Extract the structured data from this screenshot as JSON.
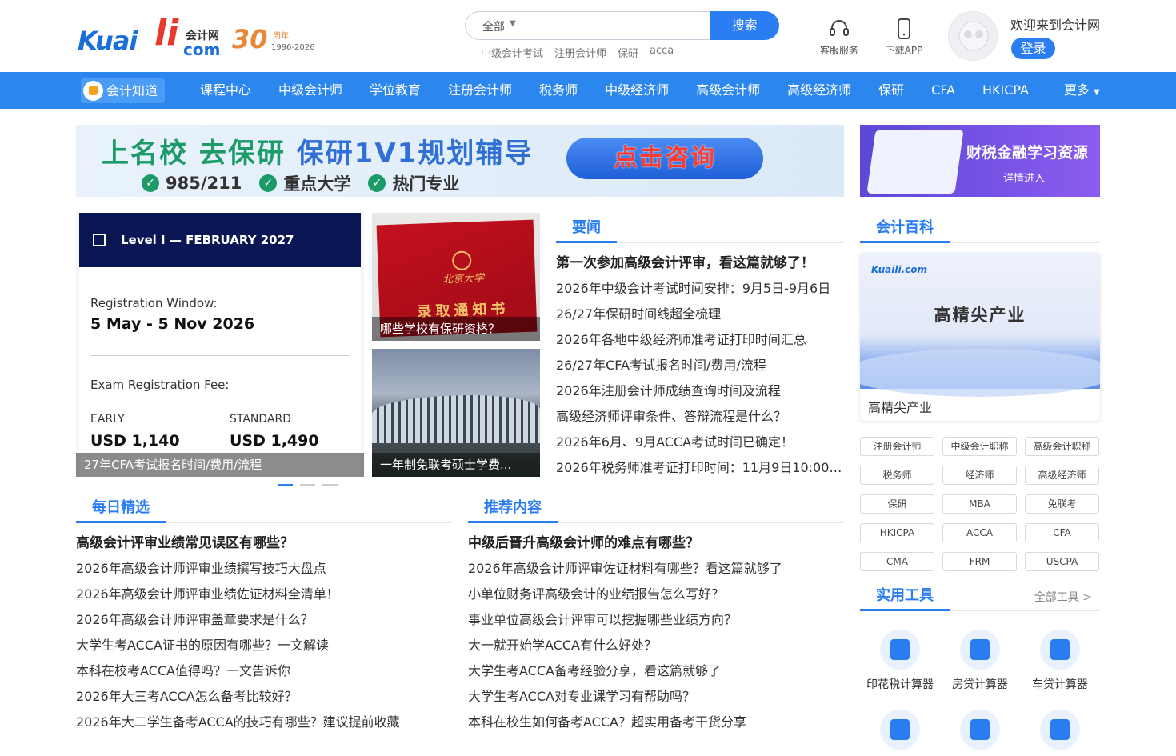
{
  "logo": {
    "kuai": "Kuai",
    "li": "li",
    "kjw": "会计网",
    "com": "com",
    "thirty": "30",
    "zhou": "周年",
    "years": "1996-2026"
  },
  "search": {
    "scope": "全部",
    "button": "搜索",
    "hotwords": [
      "中级会计考试",
      "注册会计师",
      "保研",
      "acca"
    ]
  },
  "header": {
    "service": "客服服务",
    "app": "下载APP",
    "welcome": "欢迎来到会计网",
    "login": "登录"
  },
  "nav": {
    "zhidao": "会计知道",
    "items": [
      "课程中心",
      "中级会计师",
      "学位教育",
      "注册会计师",
      "税务师",
      "中级经济师",
      "高级会计师",
      "高级经济师",
      "保研",
      "CFA",
      "HKICPA"
    ],
    "more": "更多"
  },
  "banner": {
    "line1a": "上名校 去保研 ",
    "line1b": "保研1V1规划辅导",
    "checks": [
      "985/211",
      "重点大学",
      "热门专业"
    ],
    "cta": "点击咨询"
  },
  "rbanner": {
    "title": "财税金融学习资源",
    "sub": "详情进入"
  },
  "slide": {
    "top": "Level I — FEBRUARY 2027",
    "reg_label": "Registration Window:",
    "reg_value": "5 May - 5 Nov 2026",
    "fee_label": "Exam Registration Fee:",
    "early": "EARLY",
    "standard": "STANDARD",
    "early_val": "USD 1,140",
    "standard_val": "USD 1,490",
    "caption": "27年CFA考试报名时间/费用/流程"
  },
  "thumbs": [
    {
      "pku": "北京大学",
      "tz": "录取通知书",
      "caption": "哪些学校有保研资格？"
    },
    {
      "caption": "一年制免联考硕士学费..."
    }
  ],
  "yaowen": {
    "title": "要闻",
    "items": [
      "第一次参加高级会计评审，看这篇就够了！",
      "2026年中级会计考试时间安排：9月5日-9月6日",
      "26/27年保研时间线超全梳理",
      "2026年各地中级经济师准考证打印时间汇总",
      "26/27年CFA考试报名时间/费用/流程",
      "2026年注册会计师成绩查询时间及流程",
      "高级经济师评审条件、答辩流程是什么？",
      "2026年6月、9月ACCA考试时间已确定！",
      "2026年税务师准考证打印时间：11月9日10:00至..."
    ]
  },
  "daily": {
    "title": "每日精选",
    "items": [
      "高级会计评审业绩常见误区有哪些？",
      "2026年高级会计师评审业绩撰写技巧大盘点",
      "2026年高级会计师评审业绩佐证材料全清单！",
      "2026年高级会计师评审盖章要求是什么？",
      "大学生考ACCA证书的原因有哪些？一文解读",
      "本科在校考ACCA值得吗？一文告诉你",
      "2026年大三考ACCA怎么备考比较好？",
      "2026年大二学生备考ACCA的技巧有哪些？建议提前收藏"
    ]
  },
  "recommend": {
    "title": "推荐内容",
    "items": [
      "中级后晋升高级会计师的难点有哪些？",
      "2026年高级会计师评审佐证材料有哪些？看这篇就够了",
      "小单位财务评高级会计的业绩报告怎么写好？",
      "事业单位高级会计评审可以挖掘哪些业绩方向？",
      "大一就开始学ACCA有什么好处？",
      "大学生考ACCA备考经验分享，看这篇就够了",
      "大学生考ACCA对专业课学习有帮助吗？",
      "本科在校生如何备考ACCA？超实用备考干货分享"
    ]
  },
  "baike": {
    "title": "会计百科",
    "logo": "Kuaili.com",
    "image_text": "高精尖产业",
    "caption": "高精尖产业"
  },
  "tags": [
    "注册会计师",
    "中级会计职称",
    "高级会计职称",
    "税务师",
    "经济师",
    "高级经济师",
    "保研",
    "MBA",
    "免联考",
    "HKICPA",
    "ACCA",
    "CFA",
    "CMA",
    "FRM",
    "USCPA"
  ],
  "tools": {
    "title": "实用工具",
    "more": "全部工具 >",
    "items": [
      "印花税计算器",
      "房贷计算器",
      "车贷计算器"
    ]
  },
  "colors": {
    "accent": "#2b7ef2",
    "nav": "#2b86ee"
  }
}
